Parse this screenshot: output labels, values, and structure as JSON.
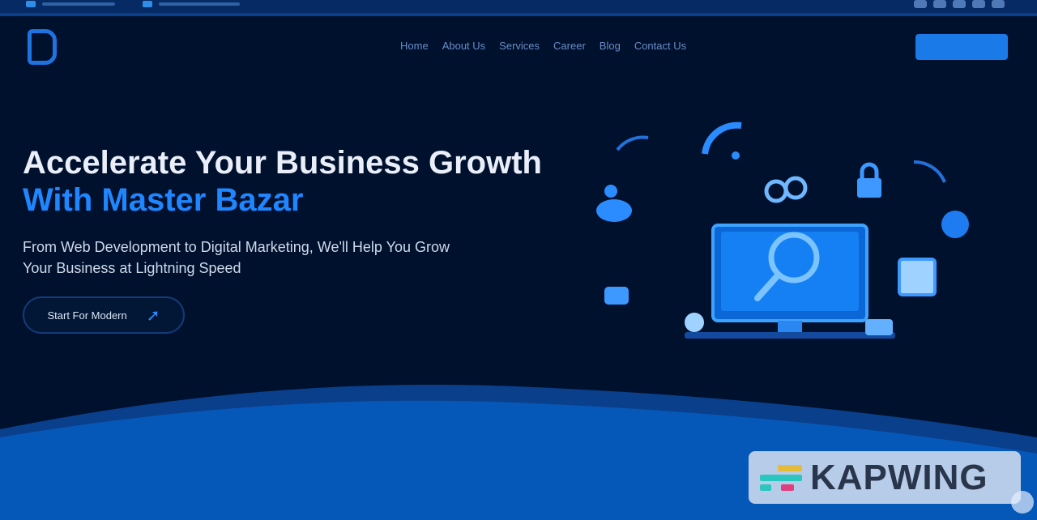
{
  "colors": {
    "background": "#00112e",
    "accent": "#1f86ff",
    "top_bar": "#062a63",
    "wave": "#0658b8"
  },
  "topbar": {
    "contacts": [
      {
        "icon": "phone-icon"
      },
      {
        "icon": "email-icon"
      }
    ],
    "socials": [
      "facebook-icon",
      "twitter-icon",
      "linkedin-icon",
      "instagram-icon",
      "youtube-icon"
    ]
  },
  "header": {
    "logo": {
      "icon": "logo-mark"
    },
    "nav": [
      {
        "label": "Home"
      },
      {
        "label": "About Us"
      },
      {
        "label": "Services"
      },
      {
        "label": "Career"
      },
      {
        "label": "Blog"
      },
      {
        "label": "Contact Us"
      }
    ],
    "cta": {
      "label": ""
    }
  },
  "hero": {
    "title_line1": "Accelerate Your Business Growth",
    "title_line2": "With Master Bazar",
    "subtitle": "From Web Development to Digital Marketing, We'll Help You Grow Your Business at Lightning Speed",
    "button": {
      "label": "Start For Modern",
      "icon": "arrow-up-right-icon"
    }
  },
  "illustration": {
    "icons": [
      "monitor-icon",
      "search-icon",
      "wifi-icon",
      "chat-icon",
      "lock-icon",
      "globe-icon",
      "link-icon",
      "document-icon",
      "cloud-icon",
      "headset-icon"
    ]
  },
  "watermark": {
    "text": "KAPWING"
  }
}
